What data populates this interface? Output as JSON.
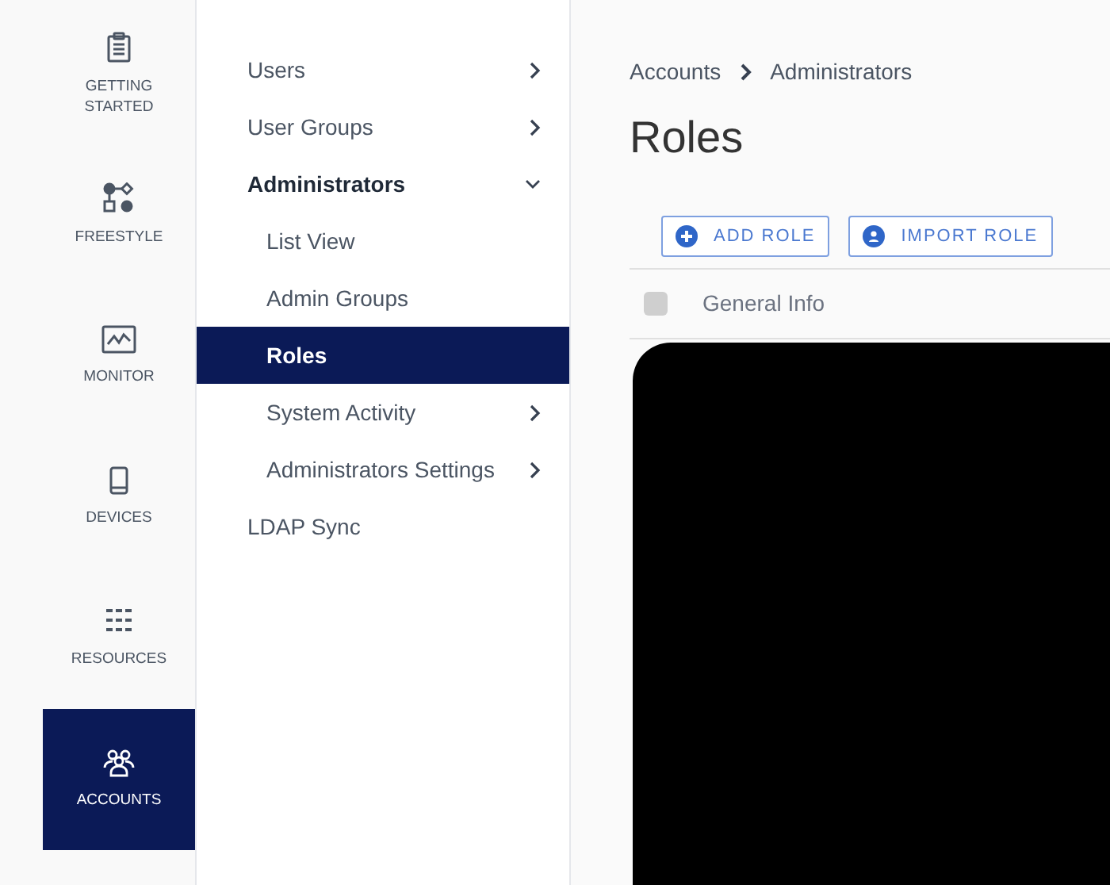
{
  "rail": [
    {
      "label": "GETTING STARTED",
      "selected": false
    },
    {
      "label": "FREESTYLE",
      "selected": false
    },
    {
      "label": "MONITOR",
      "selected": false
    },
    {
      "label": "DEVICES",
      "selected": false
    },
    {
      "label": "RESOURCES",
      "selected": false
    },
    {
      "label": "ACCOUNTS",
      "selected": true
    }
  ],
  "menu": [
    {
      "label": "Users",
      "kind": "group",
      "expanded": false,
      "selected": false
    },
    {
      "label": "User Groups",
      "kind": "group",
      "expanded": false,
      "selected": false
    },
    {
      "label": "Administrators",
      "kind": "group",
      "expanded": true,
      "selected": false,
      "children": [
        {
          "label": "List View",
          "kind": "link",
          "selected": false
        },
        {
          "label": "Admin Groups",
          "kind": "link",
          "selected": false
        },
        {
          "label": "Roles",
          "kind": "link",
          "selected": true
        },
        {
          "label": "System Activity",
          "kind": "group",
          "expanded": false,
          "selected": false
        },
        {
          "label": "Administrators Settings",
          "kind": "group",
          "expanded": false,
          "selected": false
        }
      ]
    },
    {
      "label": "LDAP Sync",
      "kind": "link",
      "selected": false
    }
  ],
  "breadcrumb": [
    "Accounts",
    "Administrators"
  ],
  "title": "Roles",
  "buttons": [
    {
      "label": "ADD ROLE",
      "kind": "add"
    },
    {
      "label": "IMPORT ROLE",
      "kind": "import"
    }
  ],
  "table": {
    "select_all_checked": false,
    "columns": [
      "General Info"
    ]
  }
}
